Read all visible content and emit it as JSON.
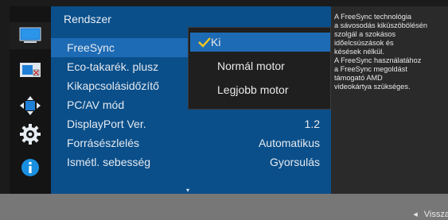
{
  "sidebar": {
    "icons": [
      "monitor-icon",
      "screen-adjust-icon",
      "position-arrows-icon",
      "settings-gear-icon",
      "info-icon"
    ],
    "active_index": 0
  },
  "menu": {
    "title": "Rendszer",
    "items": [
      {
        "label": "FreeSync",
        "value": ""
      },
      {
        "label": "Eco-takarék. plusz",
        "value": ""
      },
      {
        "label": "Kikapcsolásidőzítő",
        "value": ""
      },
      {
        "label": "PC/AV mód",
        "value": "▸"
      },
      {
        "label": "DisplayPort Ver.",
        "value": "1.2"
      },
      {
        "label": "Forrásészlelés",
        "value": "Automatikus"
      },
      {
        "label": "Ismétl. sebesség",
        "value": "Gyorsulás"
      }
    ],
    "selected_index": 0,
    "scroll_indicator": "▾"
  },
  "dropdown": {
    "options": [
      "Ki",
      "Normál motor",
      "Legjobb motor"
    ],
    "selected_index": 0,
    "check_color": "#f2c81e"
  },
  "info": {
    "text": "A FreeSync technológia\na sávosodás kiküszöbölésén\nszolgál a szokásos\nidőelcsúszások és\nkésések nélkül.\nA FreeSync használatához\na FreeSync megoldást\ntámogató AMD\nvideokártya szükséges."
  },
  "footer": {
    "back_label": "Vissza"
  },
  "colors": {
    "menu_bg": "#0a4f8a",
    "highlight": "#1d6bb5",
    "info_accent": "#1a8fe0"
  }
}
